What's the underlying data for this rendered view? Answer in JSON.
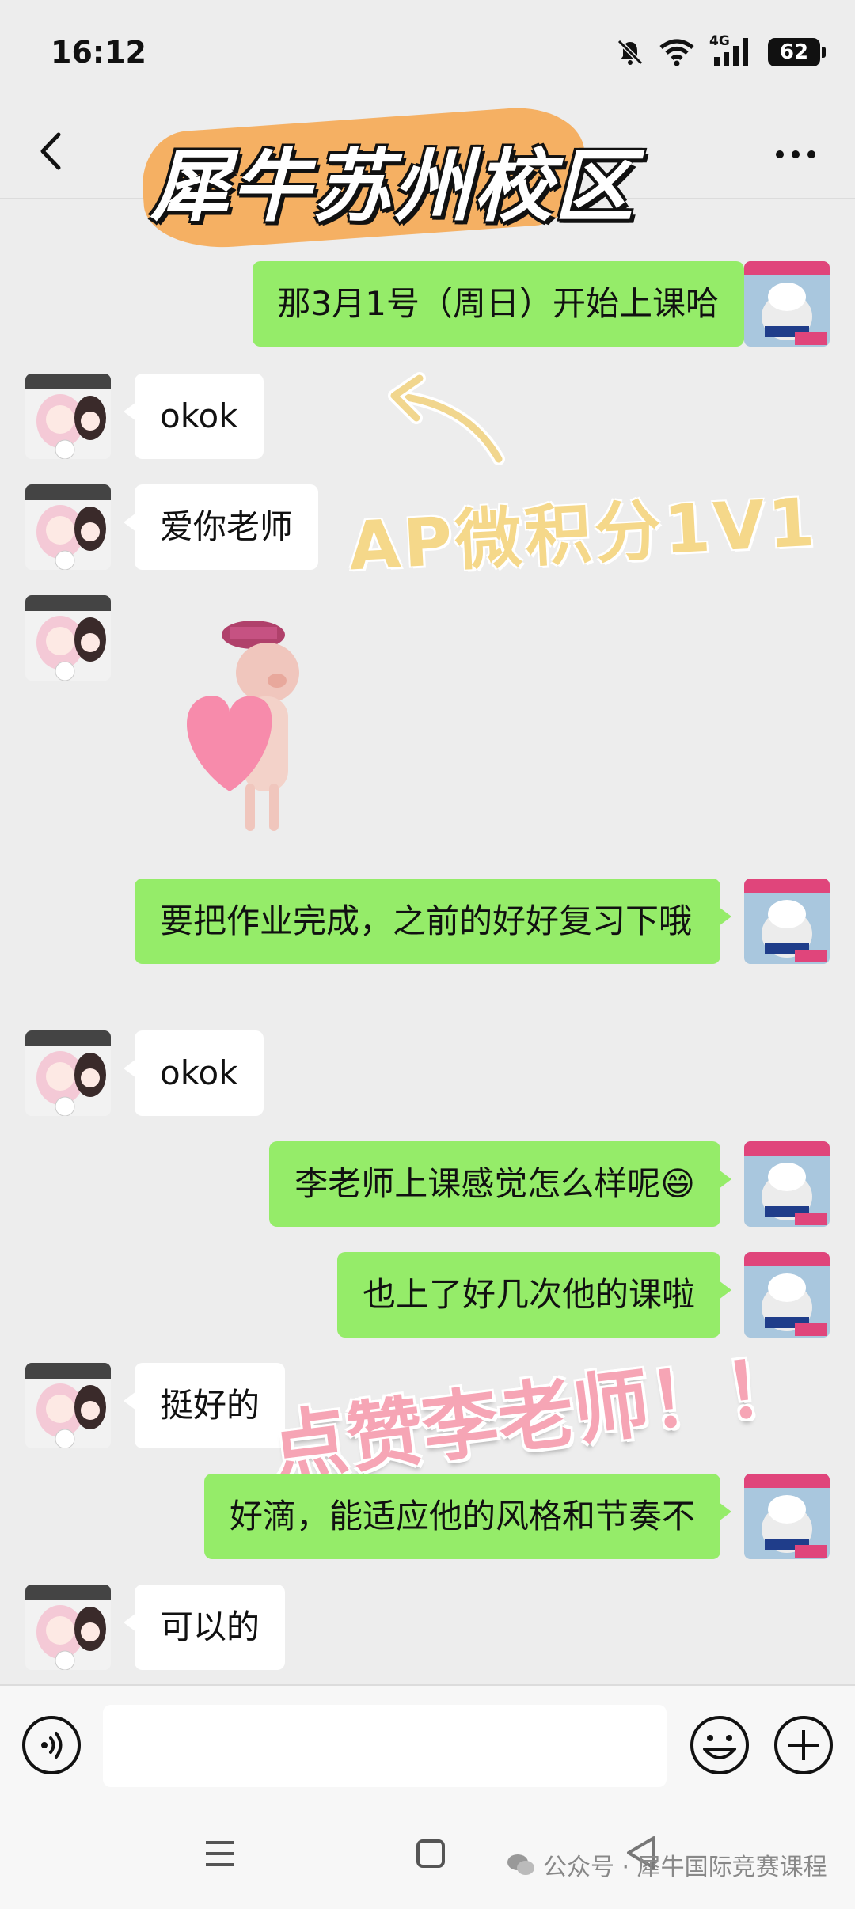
{
  "status_bar": {
    "time": "16:12",
    "network": "4G",
    "battery": "62"
  },
  "header": {
    "title": "犀牛苏州校区"
  },
  "overlays": {
    "ap_caption": "AP微积分1V1",
    "praise_caption": "点赞李老师！！"
  },
  "messages": [
    {
      "sender": "me",
      "text": "那3月1号（周日）开始上课哈"
    },
    {
      "sender": "other",
      "text": "okok"
    },
    {
      "sender": "other",
      "text": "爱你老师"
    },
    {
      "sender": "other",
      "type": "sticker",
      "sticker": "heart-pig-sticker"
    },
    {
      "sender": "me",
      "text": "要把作业完成，之前的好好复习下哦"
    },
    {
      "sender": "other",
      "text": "okok"
    },
    {
      "sender": "me",
      "text": "李老师上课感觉怎么样呢😄"
    },
    {
      "sender": "me",
      "text": "也上了好几次他的课啦"
    },
    {
      "sender": "other",
      "text": "挺好的"
    },
    {
      "sender": "me",
      "text": "好滴，能适应他的风格和节奏不"
    },
    {
      "sender": "other",
      "text": "可以的"
    }
  ],
  "watermark": {
    "text": "公众号 · 犀牛国际竞赛课程"
  },
  "colors": {
    "background": "#ededed",
    "my_bubble": "#95ec69",
    "other_bubble": "#ffffff",
    "title_brush": "#f6ad5c"
  }
}
